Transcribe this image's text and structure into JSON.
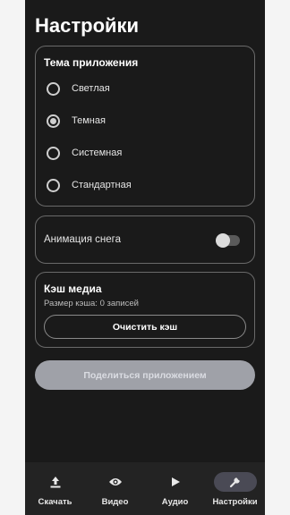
{
  "page": {
    "title": "Настройки"
  },
  "theme": {
    "title": "Тема приложения",
    "options": [
      {
        "label": "Светлая",
        "selected": false
      },
      {
        "label": "Темная",
        "selected": true
      },
      {
        "label": "Системная",
        "selected": false
      },
      {
        "label": "Стандартная",
        "selected": false
      }
    ]
  },
  "snow": {
    "label": "Анимация снега",
    "enabled": false
  },
  "cache": {
    "title": "Кэш медиа",
    "size_text": "Размер кэша: 0 записей",
    "clear_label": "Очистить кэш"
  },
  "share": {
    "label": "Поделиться приложением"
  },
  "nav": {
    "items": [
      {
        "label": "Скачать",
        "icon": "download-icon",
        "active": false
      },
      {
        "label": "Видео",
        "icon": "eye-icon",
        "active": false
      },
      {
        "label": "Аудио",
        "icon": "play-icon",
        "active": false
      },
      {
        "label": "Настройки",
        "icon": "wrench-icon",
        "active": true
      }
    ]
  },
  "colors": {
    "background": "#1a1a1a",
    "card_border": "#6a6a6a",
    "share_button": "#9fa1a8",
    "nav_background": "#232323",
    "nav_active": "#4a4a55"
  }
}
